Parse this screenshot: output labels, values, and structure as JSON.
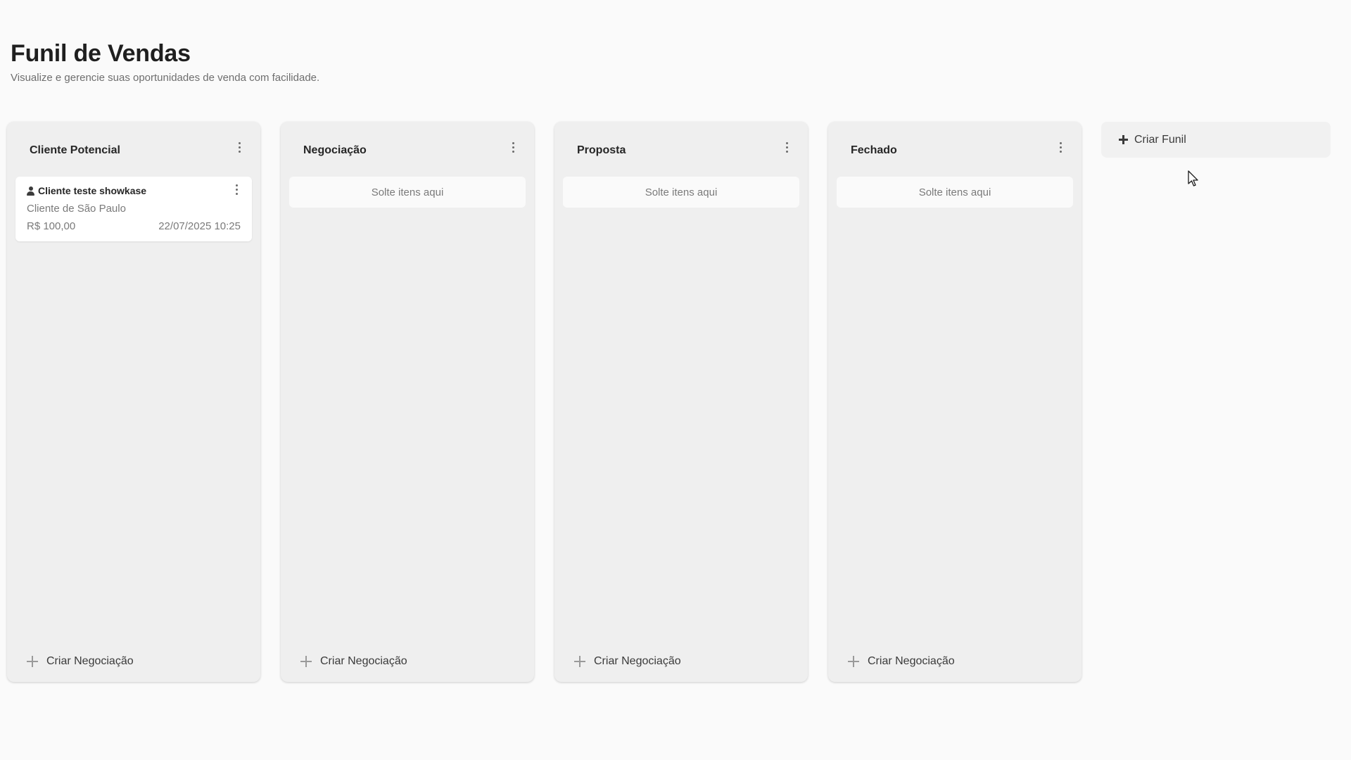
{
  "header": {
    "title": "Funil de Vendas",
    "subtitle": "Visualize e gerencie suas oportunidades de venda com facilidade."
  },
  "columns": [
    {
      "title": "Cliente Potencial",
      "footer_label": "Criar Negociação",
      "cards": [
        {
          "name": "Cliente teste showkase",
          "subtitle": "Cliente de São Paulo",
          "value": "R$ 100,00",
          "date": "22/07/2025 10:25"
        }
      ]
    },
    {
      "title": "Negociação",
      "footer_label": "Criar Negociação",
      "empty_label": "Solte itens aqui"
    },
    {
      "title": "Proposta",
      "footer_label": "Criar Negociação",
      "empty_label": "Solte itens aqui"
    },
    {
      "title": "Fechado",
      "footer_label": "Criar Negociação",
      "empty_label": "Solte itens aqui"
    }
  ],
  "create_funnel": {
    "label": "Criar Funil"
  }
}
